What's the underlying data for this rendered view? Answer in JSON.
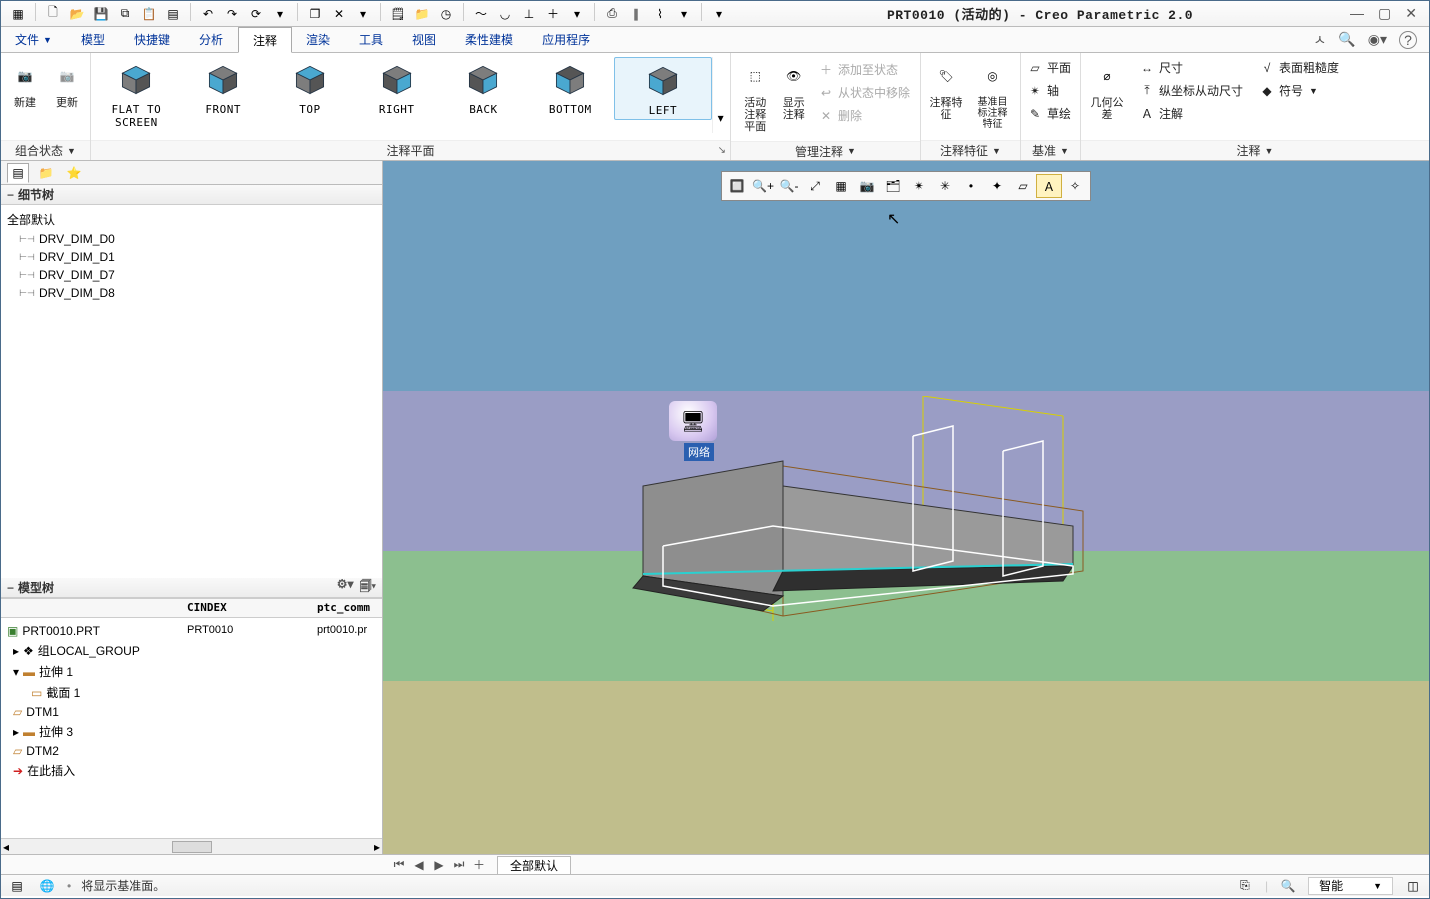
{
  "title": "PRT0010 (活动的) - Creo Parametric 2.0",
  "menubar": {
    "file": "文件",
    "tabs": [
      "模型",
      "快捷键",
      "分析",
      "注释",
      "渲染",
      "工具",
      "视图",
      "柔性建模",
      "应用程序"
    ],
    "active_index": 3
  },
  "ribbon": {
    "group_combine": "组合状态",
    "group_annot_plane": "注释平面",
    "group_manage": "管理注释",
    "group_feat": "注释特征",
    "group_datum": "基准",
    "group_annot": "注释",
    "new_btn": "新建",
    "update_btn": "更新",
    "views": {
      "flat": "FLAT TO SCREEN",
      "front": "FRONT",
      "top": "TOP",
      "right": "RIGHT",
      "back": "BACK",
      "bottom": "BOTTOM",
      "left": "LEFT"
    },
    "active_plane": "活动注释平面",
    "show_annot": "显示注释",
    "add_state": "添加至状态",
    "remove_state": "从状态中移除",
    "delete": "删除",
    "annot_feat": "注释特征",
    "datum_target": "基准目标注释特征",
    "datum_lbls": {
      "plane": "平面",
      "axis": "轴",
      "sketch": "草绘"
    },
    "geom_tol": "几何公差",
    "dim": "尺寸",
    "ord_dim": "纵坐标从动尺寸",
    "note": "注解",
    "surf_rough": "表面粗糙度",
    "symbol": "符号"
  },
  "detail_tree": {
    "title": "细节树",
    "default_all": "全部默认",
    "items": [
      "DRV_DIM_D0",
      "DRV_DIM_D1",
      "DRV_DIM_D7",
      "DRV_DIM_D8"
    ]
  },
  "model_tree": {
    "title": "模型树",
    "cols": {
      "name_w": 180,
      "cindex": "CINDEX",
      "ptc": "ptc_comm"
    },
    "root": {
      "name": "PRT0010.PRT",
      "cindex": "PRT0010",
      "ptc": "prt0010.pr"
    },
    "items": [
      {
        "name": "组LOCAL_GROUP",
        "indent": 1,
        "ico": "group"
      },
      {
        "name": "拉伸 1",
        "indent": 1,
        "ico": "extrude"
      },
      {
        "name": "截面 1",
        "indent": 2,
        "ico": "sketch"
      },
      {
        "name": "DTM1",
        "indent": 1,
        "ico": "datum"
      },
      {
        "name": "拉伸 3",
        "indent": 1,
        "ico": "extrude"
      },
      {
        "name": "DTM2",
        "indent": 1,
        "ico": "datum"
      },
      {
        "name": "在此插入",
        "indent": 1,
        "ico": "insert"
      }
    ]
  },
  "view_nav": {
    "tab": "全部默认"
  },
  "statusbar": {
    "msg": "将显示基准面。",
    "filter": "智能"
  },
  "canvas": {
    "desktop_icon": "网络"
  },
  "colors": {
    "cube_face": "#4aa8d0",
    "cube_face_dk": "#2a7aa0",
    "cube_sel": "#4aa8d0"
  }
}
